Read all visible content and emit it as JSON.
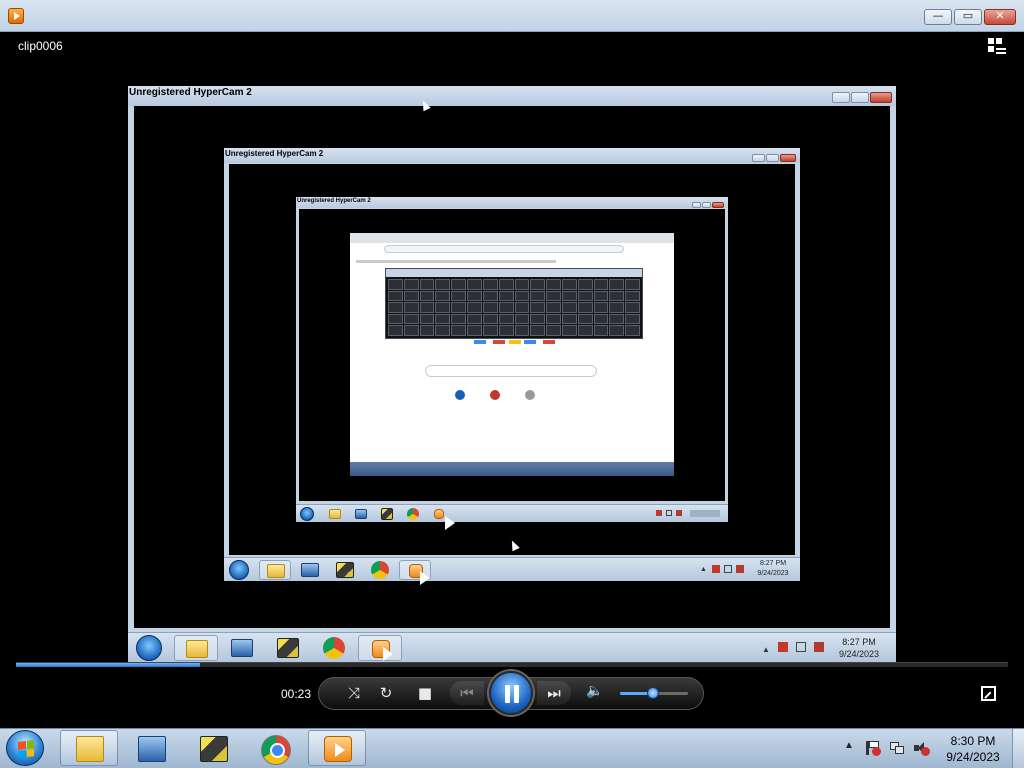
{
  "window": {
    "title_icon": "media-player-icon",
    "buttons": {
      "minimize": "—",
      "maximize": "▭",
      "close": "✕"
    }
  },
  "clip": {
    "title": "clip0006",
    "switch_icon": "switch-to-library-icon"
  },
  "recordings": [
    {
      "title": "Unregistered HyperCam 2",
      "clock_time": "8:27 PM",
      "clock_date": "9/24/2023"
    },
    {
      "title": "Unregistered HyperCam 2",
      "clock_time": "8:27 PM",
      "clock_date": "9/24/2023"
    },
    {
      "title": "Unregistered HyperCam 2"
    }
  ],
  "player": {
    "elapsed": "00:23",
    "progress_fraction": 0.185,
    "volume_fraction": 0.5,
    "state": "playing",
    "icons": [
      "shuffle-icon",
      "repeat-icon",
      "stop-icon",
      "previous-icon",
      "pause-icon",
      "next-icon",
      "volume-icon",
      "fullscreen-icon"
    ],
    "glyphs": {
      "shuffle": "⤨",
      "repeat": "↻",
      "stop": "■",
      "previous": "⏮",
      "next": "⏭",
      "volume": "🔈"
    }
  },
  "taskbar": {
    "pinned": [
      "Windows Explorer",
      "Computer",
      "HyperCam 2",
      "Google Chrome",
      "Windows Media Player"
    ],
    "clock_time": "8:30 PM",
    "clock_date": "9/24/2023",
    "tray_glyphs": {
      "show_hidden": "▲"
    }
  },
  "colors": {
    "accent": "#2f73c9",
    "taskbar": "#c9d9ea",
    "background": "#000000"
  }
}
